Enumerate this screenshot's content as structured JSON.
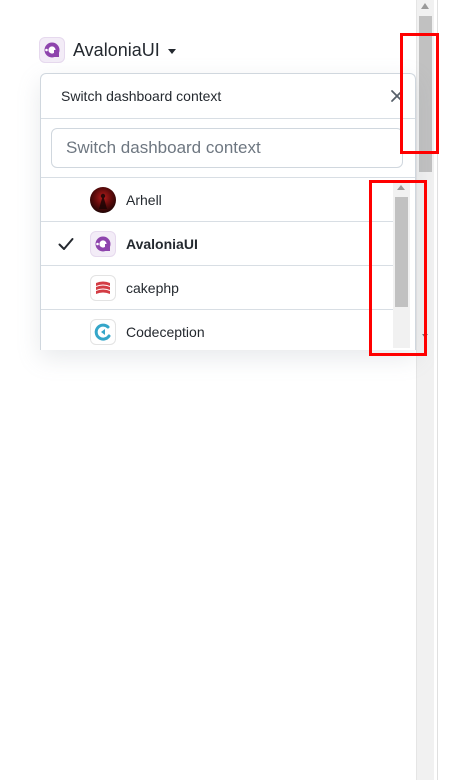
{
  "header": {
    "context_name": "AvaloniaUI",
    "avatar_icon": "avaloniaui-logo-icon",
    "caret_icon": "caret-down-icon"
  },
  "dropdown": {
    "title": "Switch dashboard context",
    "close_icon": "close-icon",
    "filter": {
      "placeholder": "Switch dashboard context",
      "value": ""
    },
    "items": [
      {
        "label": "Arhell",
        "icon": "arhell-avatar",
        "selected": false
      },
      {
        "label": "AvaloniaUI",
        "icon": "avaloniaui-logo-icon",
        "selected": true
      },
      {
        "label": "cakephp",
        "icon": "cakephp-logo-icon",
        "selected": false
      },
      {
        "label": "Codeception",
        "icon": "codeception-logo-icon",
        "selected": false
      }
    ]
  },
  "colors": {
    "highlight": "#ff0000",
    "avalonia_purple": "#8e44ad",
    "cakephp_red": "#d33c44",
    "codeception_teal": "#35a6c9"
  }
}
